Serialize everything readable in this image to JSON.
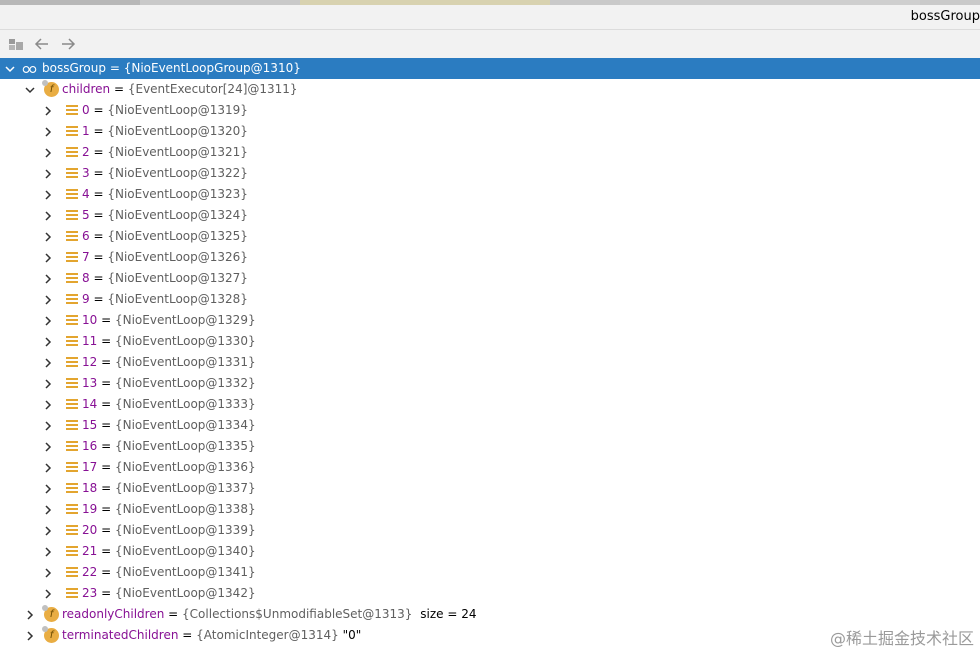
{
  "window": {
    "title": "bossGroup"
  },
  "toolbar": {
    "buttons": [
      {
        "name": "restore-layout-icon",
        "label": ""
      },
      {
        "name": "back-arrow-icon",
        "label": "←"
      },
      {
        "name": "forward-arrow-icon",
        "label": "→"
      }
    ]
  },
  "colors": {
    "selection": "#2b7cc1",
    "field_name": "#871094",
    "value_gray": "#5f5f5f",
    "field_icon": "#e9ad43"
  },
  "tree": {
    "root": {
      "name": "bossGroup",
      "value": "{NioEventLoopGroup@1310}"
    },
    "children_field": {
      "name": "children",
      "value": "{EventExecutor[24]@1311}"
    },
    "elements": [
      {
        "index": "0",
        "value": "{NioEventLoop@1319}"
      },
      {
        "index": "1",
        "value": "{NioEventLoop@1320}"
      },
      {
        "index": "2",
        "value": "{NioEventLoop@1321}"
      },
      {
        "index": "3",
        "value": "{NioEventLoop@1322}"
      },
      {
        "index": "4",
        "value": "{NioEventLoop@1323}"
      },
      {
        "index": "5",
        "value": "{NioEventLoop@1324}"
      },
      {
        "index": "6",
        "value": "{NioEventLoop@1325}"
      },
      {
        "index": "7",
        "value": "{NioEventLoop@1326}"
      },
      {
        "index": "8",
        "value": "{NioEventLoop@1327}"
      },
      {
        "index": "9",
        "value": "{NioEventLoop@1328}"
      },
      {
        "index": "10",
        "value": "{NioEventLoop@1329}"
      },
      {
        "index": "11",
        "value": "{NioEventLoop@1330}"
      },
      {
        "index": "12",
        "value": "{NioEventLoop@1331}"
      },
      {
        "index": "13",
        "value": "{NioEventLoop@1332}"
      },
      {
        "index": "14",
        "value": "{NioEventLoop@1333}"
      },
      {
        "index": "15",
        "value": "{NioEventLoop@1334}"
      },
      {
        "index": "16",
        "value": "{NioEventLoop@1335}"
      },
      {
        "index": "17",
        "value": "{NioEventLoop@1336}"
      },
      {
        "index": "18",
        "value": "{NioEventLoop@1337}"
      },
      {
        "index": "19",
        "value": "{NioEventLoop@1338}"
      },
      {
        "index": "20",
        "value": "{NioEventLoop@1339}"
      },
      {
        "index": "21",
        "value": "{NioEventLoop@1340}"
      },
      {
        "index": "22",
        "value": "{NioEventLoop@1341}"
      },
      {
        "index": "23",
        "value": "{NioEventLoop@1342}"
      }
    ],
    "readonly_field": {
      "name": "readonlyChildren",
      "value": "{Collections$UnmodifiableSet@1313}",
      "extra": "size = 24"
    },
    "terminated_field": {
      "name": "terminatedChildren",
      "value": "{AtomicInteger@1314}",
      "extra": "\"0\""
    }
  },
  "watermark": "@稀土掘金技术社区"
}
